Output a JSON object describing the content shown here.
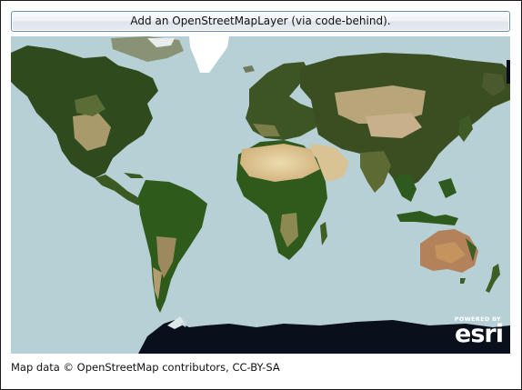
{
  "toolbar": {
    "add_layer_label": "Add an OpenStreetMapLayer (via code-behind)."
  },
  "map": {
    "logo": {
      "powered_by": "POWERED BY",
      "brand": "esri"
    },
    "colors": {
      "ocean": "#b6d0d6",
      "forest": "#2f4a1c",
      "desert": "#e0cc9c",
      "ice": "#ffffff",
      "night": "#0a0f1c"
    }
  },
  "footer": {
    "attribution": "Map data © OpenStreetMap contributors, CC-BY-SA"
  }
}
